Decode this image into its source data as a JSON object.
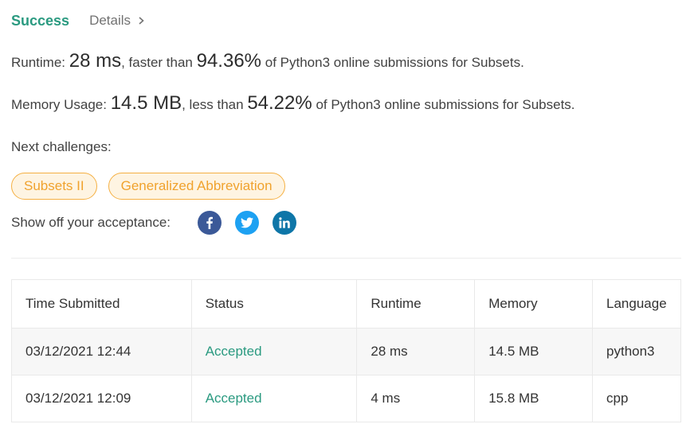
{
  "header": {
    "status": "Success",
    "details_label": "Details"
  },
  "runtime": {
    "label": "Runtime: ",
    "value": "28 ms",
    "mid": ", faster than ",
    "percent": "94.36%",
    "suffix": " of Python3 online submissions for Subsets."
  },
  "memory": {
    "label": "Memory Usage: ",
    "value": "14.5 MB",
    "mid": ", less than ",
    "percent": "54.22%",
    "suffix": " of Python3 online submissions for Subsets."
  },
  "next_challenges": {
    "label": "Next challenges:",
    "items": [
      "Subsets II",
      "Generalized Abbreviation"
    ]
  },
  "share": {
    "label": "Show off your acceptance:",
    "icons": [
      "facebook-icon",
      "twitter-icon",
      "linkedin-icon"
    ]
  },
  "table": {
    "headers": [
      "Time Submitted",
      "Status",
      "Runtime",
      "Memory",
      "Language"
    ],
    "rows": [
      [
        "03/12/2021 12:44",
        "Accepted",
        "28 ms",
        "14.5 MB",
        "python3"
      ],
      [
        "03/12/2021 12:09",
        "Accepted",
        "4 ms",
        "15.8 MB",
        "cpp"
      ]
    ]
  },
  "colors": {
    "success": "#2a9a80",
    "chip_text": "#f0a22d",
    "chip_border": "#f5b043",
    "chip_bg": "#fef4e2",
    "facebook": "#3b5998",
    "twitter": "#1da1f2",
    "linkedin": "#0e76a8"
  }
}
